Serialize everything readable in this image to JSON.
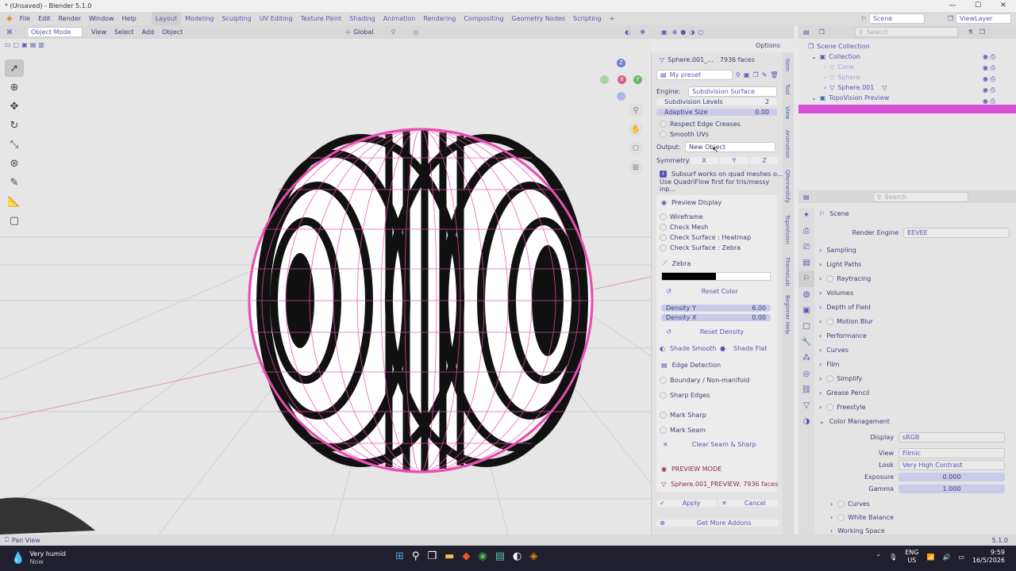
{
  "window": {
    "title": "* (Unsaved) - Blender 5.1.0",
    "min": "—",
    "max": "☐",
    "close": "✕"
  },
  "menu": [
    "File",
    "Edit",
    "Render",
    "Window",
    "Help"
  ],
  "workspaces": [
    "Layout",
    "Modeling",
    "Sculpting",
    "UV Editing",
    "Texture Paint",
    "Shading",
    "Animation",
    "Rendering",
    "Compositing",
    "Geometry Nodes",
    "Scripting"
  ],
  "add_tab": "+",
  "scene": {
    "scene_name": "Scene",
    "view_layer": "ViewLayer"
  },
  "viewport_header": {
    "mode": "Object Mode",
    "menus": [
      "View",
      "Select",
      "Add",
      "Object"
    ],
    "orientation": "Global"
  },
  "options_label": "Options",
  "gizmo": {
    "z": "Z",
    "x": "X",
    "y": "Y"
  },
  "npanel": {
    "object_line": "Sphere.001_...",
    "faces": "7936 faces",
    "preset": "My preset",
    "engine_label": "Engine:",
    "engine_value": "Subdivision Surface",
    "subdiv_label": "Subdivision Levels",
    "subdiv_value": "2",
    "adaptive_label": "Adaptive Size",
    "adaptive_value": "0.00",
    "respect_creases": "Respect Edge Creases",
    "smooth_uvs": "Smooth UVs",
    "output_label": "Output:",
    "output_value": "New Object",
    "symmetry_label": "Symmetry:",
    "sym_x": "X",
    "sym_y": "Y",
    "sym_z": "Z",
    "info1": "Subsurf works on quad meshes o...",
    "info2": "Use QuadriFlow first for tris/messy inp...",
    "preview_display": "Preview Display",
    "wireframe": "Wireframe",
    "check_mesh": "Check Mesh",
    "check_heatmap": "Check Surface : Heatmap",
    "check_zebra": "Check Surface : Zebra",
    "zebra": "Zebra",
    "reset_color": "Reset Color",
    "density_y_label": "Density Y",
    "density_y_value": "6.00",
    "density_x_label": "Density X",
    "density_x_value": "0.00",
    "reset_density": "Reset Density",
    "shade_smooth": "Shade Smooth",
    "shade_flat": "Shade Flat",
    "edge_detection": "Edge Detection",
    "boundary": "Boundary / Non-manifold",
    "sharp_edges": "Sharp Edges",
    "mark_sharp": "Mark Sharp",
    "mark_seam": "Mark Seam",
    "clear_seam": "Clear Seam & Sharp",
    "preview_mode": "PREVIEW MODE",
    "preview_object": "Sphere.001_PREVIEW:  7936 faces",
    "apply": "Apply",
    "cancel": "Cancel",
    "get_addons": "Get More Addons"
  },
  "ntabs": [
    "Item",
    "Tool",
    "View",
    "Animation",
    "QRemeshify",
    "TopoVision",
    "ThemeLab",
    "Beginner Help"
  ],
  "outliner": {
    "search": "Search",
    "items": [
      "Scene Collection",
      "Collection",
      "Cone",
      "Sphere",
      "Sphere.001",
      "TopoVision Preview"
    ]
  },
  "properties": {
    "search": "Search",
    "scene": "Scene",
    "render_engine_label": "Render Engine",
    "render_engine_value": "EEVEE",
    "panels": [
      "Sampling",
      "Light Paths",
      "Raytracing",
      "Volumes",
      "Depth of Field",
      "Motion Blur",
      "Performance",
      "Curves",
      "Film",
      "Simplify",
      "Grease Pencil",
      "Freestyle",
      "Color Management"
    ],
    "display_label": "Display",
    "display_value": "sRGB",
    "view_label": "View",
    "view_value": "Filmic",
    "look_label": "Look",
    "look_value": "Very High Contrast",
    "exposure_label": "Exposure",
    "exposure_value": "0.000",
    "gamma_label": "Gamma",
    "gamma_value": "1.000",
    "sub_panels": [
      "Curves",
      "White Balance",
      "Working Space"
    ]
  },
  "status": {
    "left": "Pan View",
    "right": "5.1.0"
  },
  "taskbar": {
    "weather": "Very humid",
    "weather_sub": "Now",
    "lang": "ENG",
    "lang2": "US",
    "time": "9:59",
    "date": "16/5/2026"
  },
  "colors": {
    "accent": "#5657b5",
    "mesh": "#e64fb0",
    "select": "#d94fd6"
  }
}
